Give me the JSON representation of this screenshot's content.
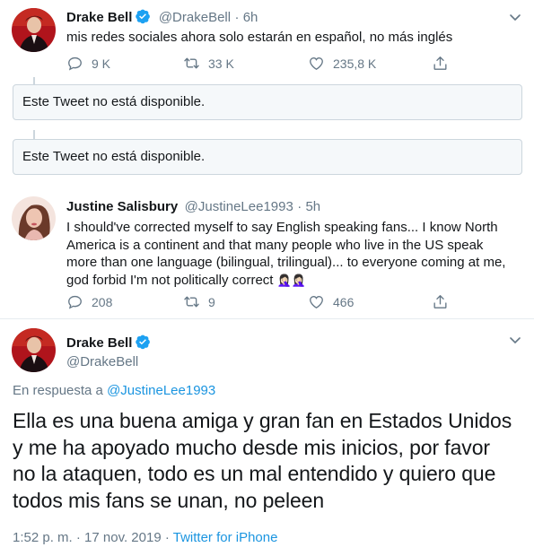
{
  "tweet1": {
    "name": "Drake Bell",
    "handle": "@DrakeBell",
    "time": "· 6h",
    "text": "mis redes sociales ahora solo estarán en español, no más inglés",
    "replies": "9 K",
    "retweets": "33 K",
    "likes": "235,8 K"
  },
  "unavailable1": "Este Tweet no está disponible.",
  "unavailable2": "Este Tweet no está disponible.",
  "tweet2": {
    "name": "Justine Salisbury",
    "handle": "@JustineLee1993",
    "time": "· 5h",
    "text_lines": [
      "I should've corrected myself to say English speaking fans...  I know North",
      "America is a continent and that many people who live in the US speak",
      "more than one language (bilingual, trilingual)... to everyone coming at me,",
      "god forbid I'm not politically correct"
    ],
    "emoji": "🤦🏻‍♀️🤦🏻‍♀️",
    "replies": "208",
    "retweets": "9",
    "likes": "466"
  },
  "tweet3": {
    "name": "Drake Bell",
    "handle": "@DrakeBell",
    "reply_prefix": "En respuesta a",
    "reply_handle": "@JustineLee1993",
    "text_lines": [
      "Ella es una buena amiga y gran fan en Estados Unidos",
      "y me ha apoyado mucho desde mis inicios, por favor",
      "no la ataquen, todo es un mal entendido y quiero que",
      "todos mis fans se unan, no peleen"
    ],
    "timestamp": "1:52 p. m. · 17 nov. 2019 ·",
    "source": "Twitter for iPhone"
  },
  "icons": {
    "reply": "reply-icon",
    "retweet": "retweet-icon",
    "like": "heart-icon",
    "share": "share-icon",
    "verified": "verified-badge-icon",
    "more": "chevron-down-icon"
  },
  "colors": {
    "link": "#1b95e0",
    "secondary": "#657786",
    "verified": "#1da1f2"
  }
}
